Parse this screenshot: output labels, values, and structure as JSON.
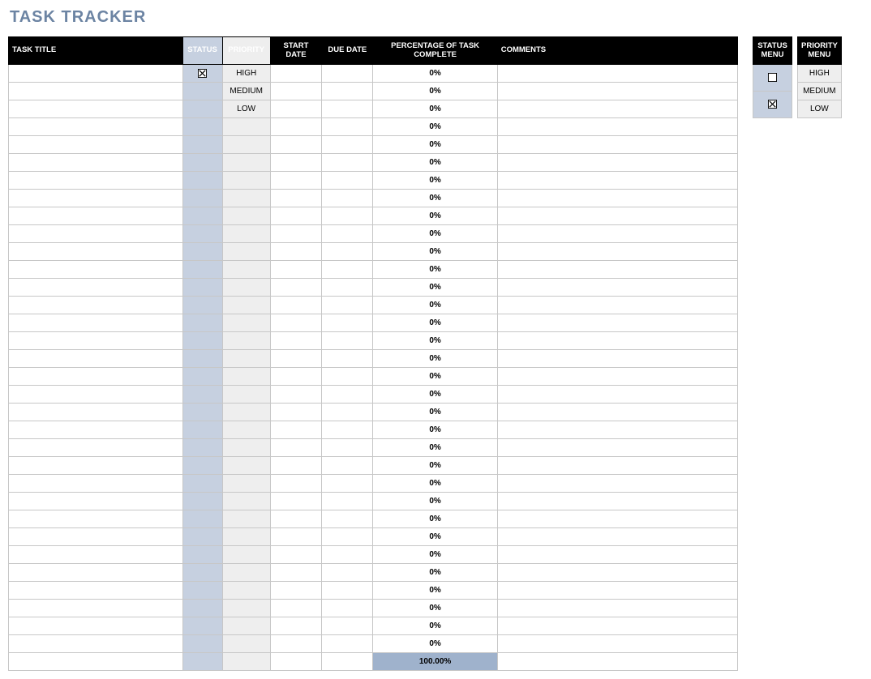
{
  "title": "TASK TRACKER",
  "columns": {
    "task_title": "TASK TITLE",
    "status": "STATUS",
    "priority": "PRIORITY",
    "start_date": "START DATE",
    "due_date": "DUE DATE",
    "percent": "PERCENTAGE OF TASK COMPLETE",
    "comments": "COMMENTS"
  },
  "rows": [
    {
      "title": "",
      "status_checked": true,
      "priority": "HIGH",
      "start": "",
      "due": "",
      "percent": "0%",
      "comments": ""
    },
    {
      "title": "",
      "status_checked": false,
      "priority": "MEDIUM",
      "start": "",
      "due": "",
      "percent": "0%",
      "comments": ""
    },
    {
      "title": "",
      "status_checked": false,
      "priority": "LOW",
      "start": "",
      "due": "",
      "percent": "0%",
      "comments": ""
    },
    {
      "title": "",
      "status_checked": false,
      "priority": "",
      "start": "",
      "due": "",
      "percent": "0%",
      "comments": ""
    },
    {
      "title": "",
      "status_checked": false,
      "priority": "",
      "start": "",
      "due": "",
      "percent": "0%",
      "comments": ""
    },
    {
      "title": "",
      "status_checked": false,
      "priority": "",
      "start": "",
      "due": "",
      "percent": "0%",
      "comments": ""
    },
    {
      "title": "",
      "status_checked": false,
      "priority": "",
      "start": "",
      "due": "",
      "percent": "0%",
      "comments": ""
    },
    {
      "title": "",
      "status_checked": false,
      "priority": "",
      "start": "",
      "due": "",
      "percent": "0%",
      "comments": ""
    },
    {
      "title": "",
      "status_checked": false,
      "priority": "",
      "start": "",
      "due": "",
      "percent": "0%",
      "comments": ""
    },
    {
      "title": "",
      "status_checked": false,
      "priority": "",
      "start": "",
      "due": "",
      "percent": "0%",
      "comments": ""
    },
    {
      "title": "",
      "status_checked": false,
      "priority": "",
      "start": "",
      "due": "",
      "percent": "0%",
      "comments": ""
    },
    {
      "title": "",
      "status_checked": false,
      "priority": "",
      "start": "",
      "due": "",
      "percent": "0%",
      "comments": ""
    },
    {
      "title": "",
      "status_checked": false,
      "priority": "",
      "start": "",
      "due": "",
      "percent": "0%",
      "comments": ""
    },
    {
      "title": "",
      "status_checked": false,
      "priority": "",
      "start": "",
      "due": "",
      "percent": "0%",
      "comments": ""
    },
    {
      "title": "",
      "status_checked": false,
      "priority": "",
      "start": "",
      "due": "",
      "percent": "0%",
      "comments": ""
    },
    {
      "title": "",
      "status_checked": false,
      "priority": "",
      "start": "",
      "due": "",
      "percent": "0%",
      "comments": ""
    },
    {
      "title": "",
      "status_checked": false,
      "priority": "",
      "start": "",
      "due": "",
      "percent": "0%",
      "comments": ""
    },
    {
      "title": "",
      "status_checked": false,
      "priority": "",
      "start": "",
      "due": "",
      "percent": "0%",
      "comments": ""
    },
    {
      "title": "",
      "status_checked": false,
      "priority": "",
      "start": "",
      "due": "",
      "percent": "0%",
      "comments": ""
    },
    {
      "title": "",
      "status_checked": false,
      "priority": "",
      "start": "",
      "due": "",
      "percent": "0%",
      "comments": ""
    },
    {
      "title": "",
      "status_checked": false,
      "priority": "",
      "start": "",
      "due": "",
      "percent": "0%",
      "comments": ""
    },
    {
      "title": "",
      "status_checked": false,
      "priority": "",
      "start": "",
      "due": "",
      "percent": "0%",
      "comments": ""
    },
    {
      "title": "",
      "status_checked": false,
      "priority": "",
      "start": "",
      "due": "",
      "percent": "0%",
      "comments": ""
    },
    {
      "title": "",
      "status_checked": false,
      "priority": "",
      "start": "",
      "due": "",
      "percent": "0%",
      "comments": ""
    },
    {
      "title": "",
      "status_checked": false,
      "priority": "",
      "start": "",
      "due": "",
      "percent": "0%",
      "comments": ""
    },
    {
      "title": "",
      "status_checked": false,
      "priority": "",
      "start": "",
      "due": "",
      "percent": "0%",
      "comments": ""
    },
    {
      "title": "",
      "status_checked": false,
      "priority": "",
      "start": "",
      "due": "",
      "percent": "0%",
      "comments": ""
    },
    {
      "title": "",
      "status_checked": false,
      "priority": "",
      "start": "",
      "due": "",
      "percent": "0%",
      "comments": ""
    },
    {
      "title": "",
      "status_checked": false,
      "priority": "",
      "start": "",
      "due": "",
      "percent": "0%",
      "comments": ""
    },
    {
      "title": "",
      "status_checked": false,
      "priority": "",
      "start": "",
      "due": "",
      "percent": "0%",
      "comments": ""
    },
    {
      "title": "",
      "status_checked": false,
      "priority": "",
      "start": "",
      "due": "",
      "percent": "0%",
      "comments": ""
    },
    {
      "title": "",
      "status_checked": false,
      "priority": "",
      "start": "",
      "due": "",
      "percent": "0%",
      "comments": ""
    },
    {
      "title": "",
      "status_checked": false,
      "priority": "",
      "start": "",
      "due": "",
      "percent": "0%",
      "comments": ""
    }
  ],
  "total_percent": "100.00%",
  "menus": {
    "status_header": "STATUS MENU",
    "priority_header": "PRIORITY MENU",
    "status_items": [
      {
        "checked": false
      },
      {
        "checked": true
      }
    ],
    "priority_items": [
      "HIGH",
      "MEDIUM",
      "LOW"
    ]
  }
}
